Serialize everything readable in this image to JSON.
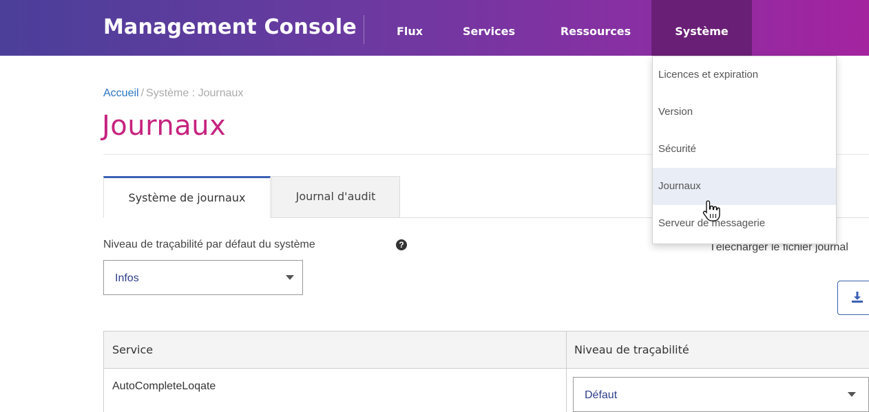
{
  "navbar": {
    "brand": "Management Console",
    "items": [
      {
        "label": "Flux"
      },
      {
        "label": "Services"
      },
      {
        "label": "Ressources"
      },
      {
        "label": "Système"
      }
    ]
  },
  "dropdown": {
    "items": [
      {
        "label": "Licences et expiration"
      },
      {
        "label": "Version"
      },
      {
        "label": "Sécurité"
      },
      {
        "label": "Journaux",
        "active": true
      },
      {
        "label": "Serveur de messagerie"
      }
    ]
  },
  "breadcrumb": {
    "home": "Accueil",
    "separator": "/",
    "current": "Système : Journaux"
  },
  "page_title": "Journaux",
  "tabs": [
    {
      "label": "Système de journaux",
      "active": true
    },
    {
      "label": "Journal d'audit",
      "active": false
    }
  ],
  "default_level": {
    "label": "Niveau de traçabilité par défaut du système",
    "help_icon": "question-circle-icon",
    "selected": "Infos"
  },
  "download": {
    "text": "Télécharger le fichier journal",
    "icon": "download-icon"
  },
  "table": {
    "headers": [
      "Service",
      "Niveau de traçabilité"
    ],
    "rows": [
      {
        "service": "AutoCompleteLoqate",
        "level": "Défaut"
      }
    ]
  },
  "colors": {
    "brand_gradient_start": "#4b3f9a",
    "brand_gradient_end": "#a4239f",
    "active_nav": "#6a1f76",
    "title": "#c6237f",
    "link": "#2a74c0",
    "accent": "#3a5fb5",
    "menu_active_bg": "#e9edf6"
  }
}
